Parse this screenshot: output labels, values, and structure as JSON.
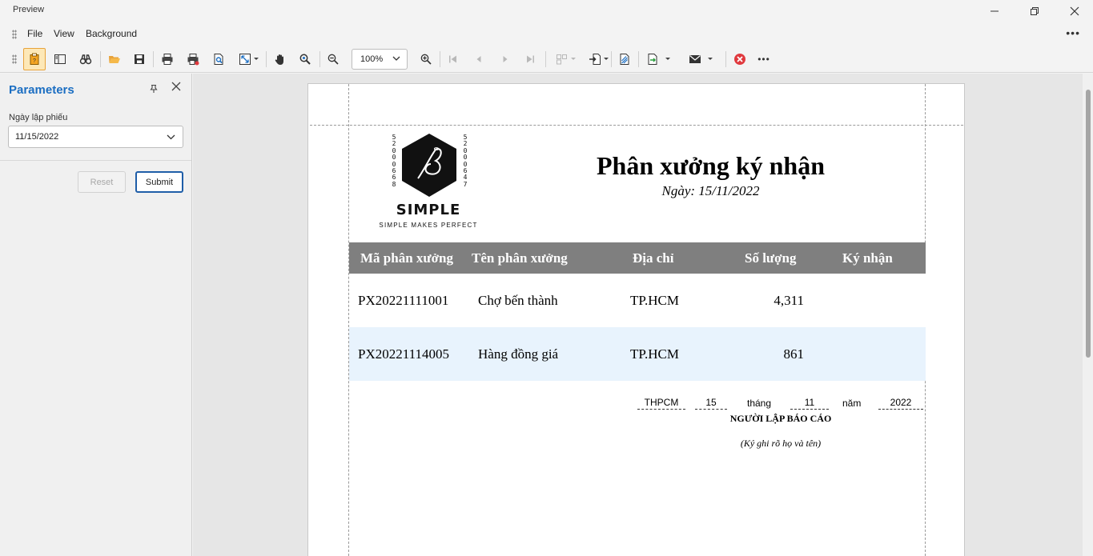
{
  "window": {
    "title": "Preview"
  },
  "menu": {
    "items": [
      "File",
      "View",
      "Background"
    ]
  },
  "toolbar": {
    "zoom_value": "100%"
  },
  "parameters": {
    "title": "Parameters",
    "date_label": "Ngày lập phiếu",
    "date_value": "11/15/2022",
    "reset_label": "Reset",
    "submit_label": "Submit"
  },
  "report": {
    "logo": {
      "brand": "SIMPLE",
      "tagline": "SIMPLE MAKES PERFECT",
      "left_digits": "52000668",
      "right_digits": "52000647"
    },
    "title": "Phân xưởng ký nhận",
    "date_line": "Ngày: 15/11/2022",
    "table": {
      "headers": [
        "Mã phân xưởng",
        "Tên phân xưởng",
        "Địa chỉ",
        "Số lượng",
        "Ký nhận"
      ],
      "rows": [
        [
          "PX20221111001",
          "Chợ bến thành",
          "TP.HCM",
          "4,311",
          ""
        ],
        [
          "PX20221114005",
          "Hàng đồng giá",
          "TP.HCM",
          "861",
          ""
        ]
      ],
      "alt_row_color": "#e8f3fd",
      "header_color": "#7f7f7f"
    },
    "signature": {
      "place": "THPCM",
      "day": "15",
      "month_word": "tháng",
      "month": "11",
      "year_word": "năm",
      "year": "2022",
      "title": "NGƯỜI LẬP BÁO CÁO",
      "note": "(Ký ghi rõ họ và tên)"
    }
  },
  "colors": {
    "accent": "#1b6ec2",
    "active_tool": "#fde8b7",
    "stop": "#e0393e"
  }
}
